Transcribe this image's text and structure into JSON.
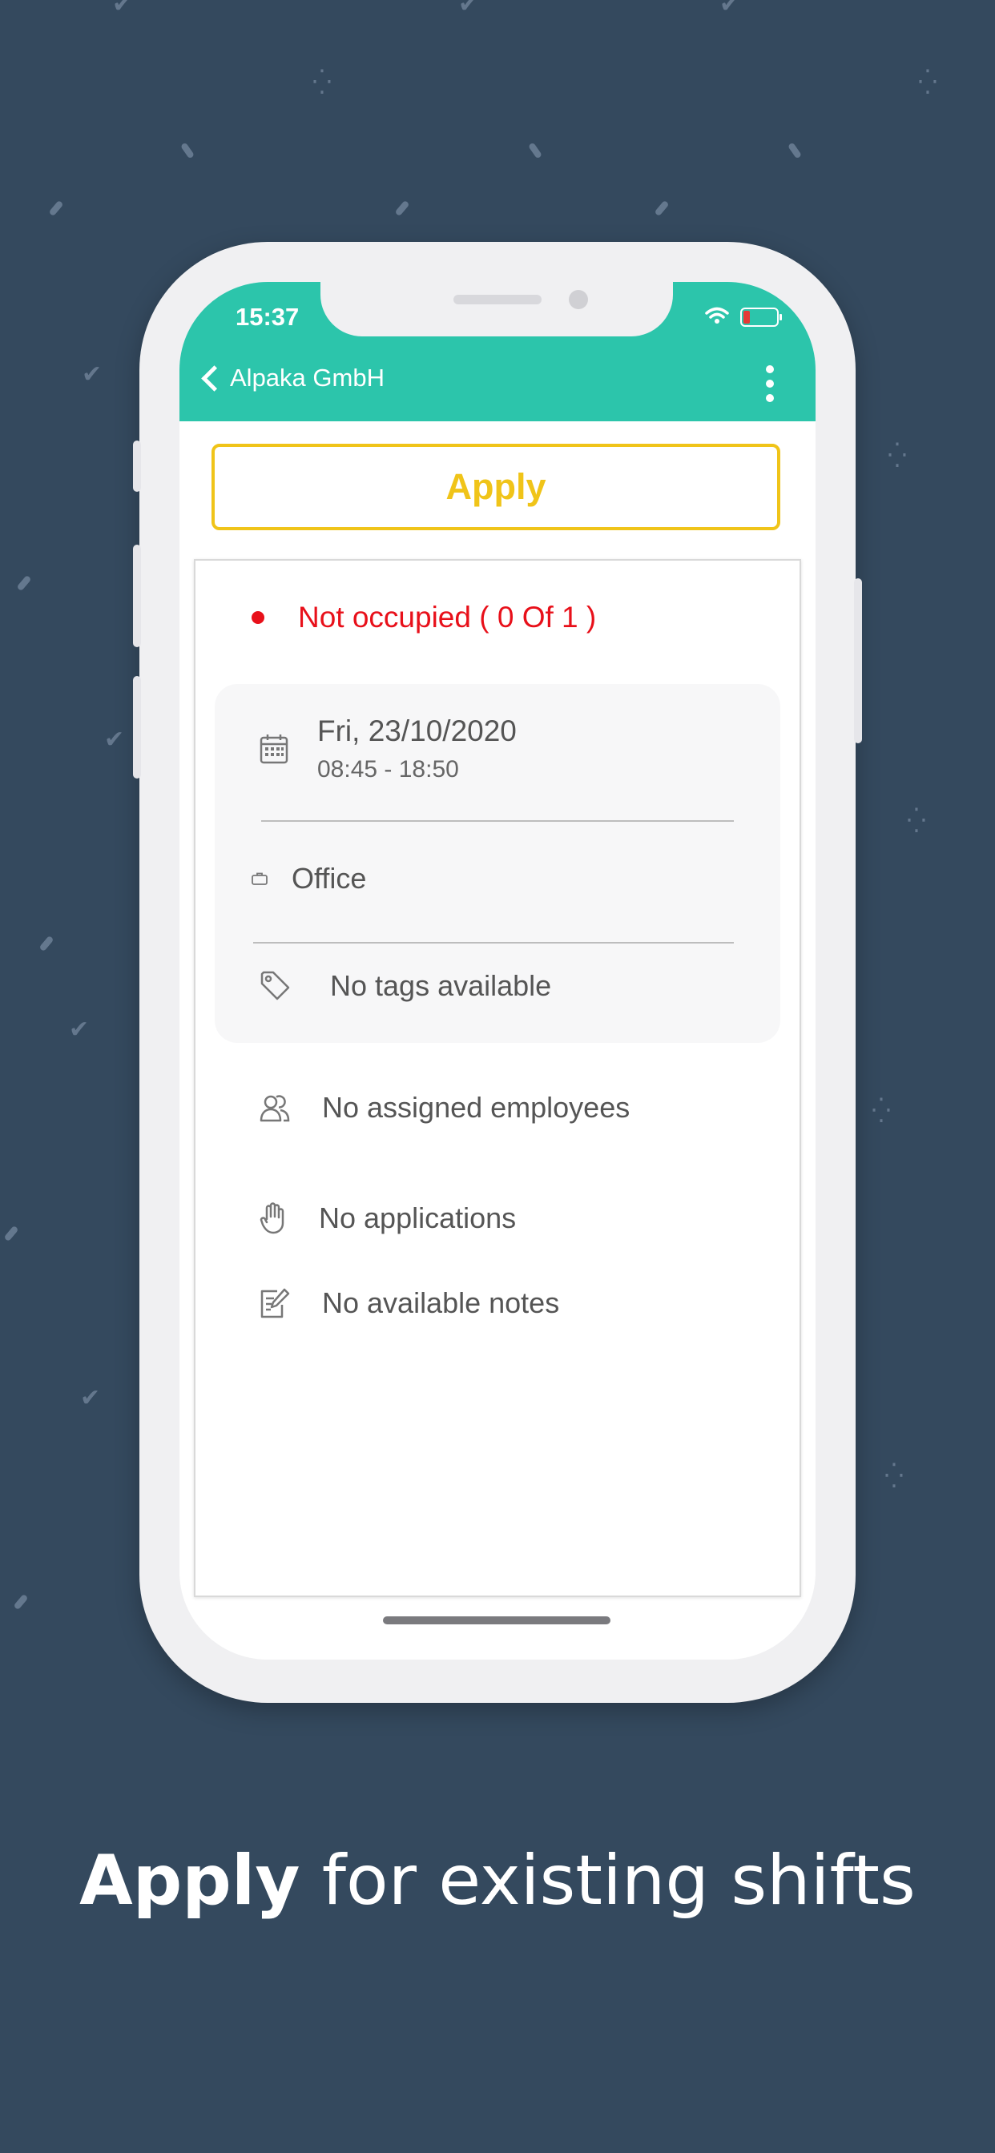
{
  "status_bar": {
    "time": "15:37"
  },
  "nav": {
    "back_label": "Alpaka GmbH"
  },
  "actions": {
    "apply_label": "Apply"
  },
  "shift": {
    "status": "Not occupied ( 0 Of 1 )",
    "date": "Fri, 23/10/2020",
    "time_range": "08:45 - 18:50",
    "location": "Office",
    "tags": "No tags available",
    "assigned": "No assigned employees",
    "applications": "No applications",
    "notes": "No available notes"
  },
  "marketing": {
    "tagline_bold": "Apply",
    "tagline_rest": " for existing shifts"
  },
  "colors": {
    "accent": "#2cc5ab",
    "apply": "#f0c419",
    "status_red": "#e8101a",
    "background": "#34495e"
  },
  "icons": [
    "chevron-left-icon",
    "more-vertical-icon",
    "calendar-icon",
    "briefcase-icon",
    "tag-icon",
    "people-icon",
    "hand-icon",
    "notes-icon",
    "wifi-icon",
    "battery-icon"
  ]
}
